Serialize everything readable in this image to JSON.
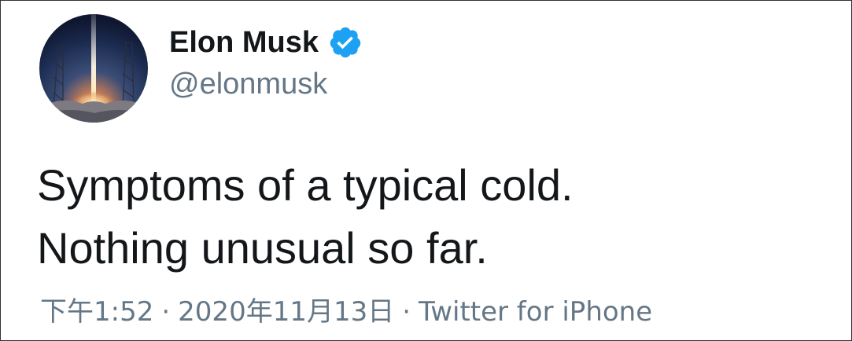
{
  "user": {
    "display_name": "Elon Musk",
    "handle": "@elonmusk",
    "verified": true,
    "avatar_icon": "rocket-launch-avatar-icon",
    "verified_icon": "verified-badge-icon",
    "verified_color": "#1da1f2"
  },
  "tweet": {
    "lines": [
      "Symptoms of a typical cold.",
      "Nothing unusual so far."
    ]
  },
  "meta": {
    "time": "下午1:52",
    "separator": "·",
    "date": "2020年11月13日",
    "source": "Twitter for iPhone"
  },
  "colors": {
    "text": "#14171a",
    "secondary": "#657786",
    "accent": "#1da1f2",
    "background": "#ffffff"
  }
}
